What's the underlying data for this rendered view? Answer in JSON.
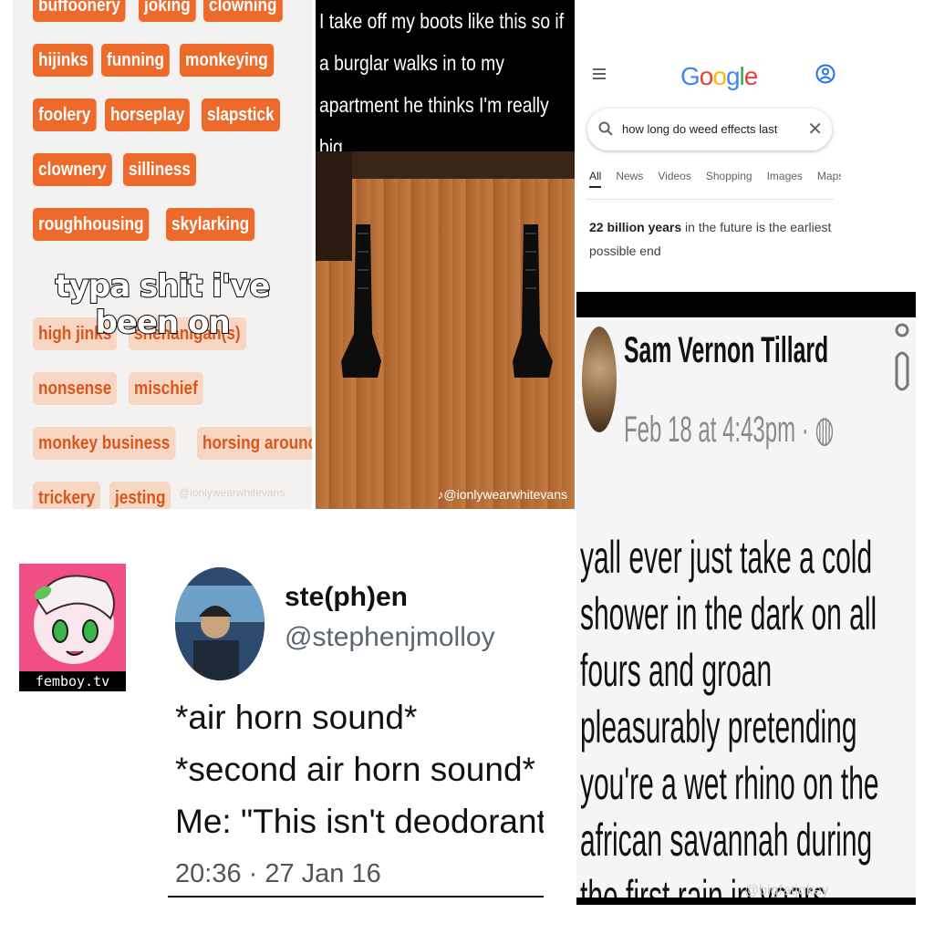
{
  "words_panel": {
    "tags_strong": [
      [
        "buffoonery",
        "joking",
        "clowning"
      ],
      [
        "hijinks",
        "funning",
        "monkeying"
      ],
      [
        "foolery",
        "horseplay",
        "slapstick"
      ],
      [
        "clownery",
        "silliness"
      ],
      [
        "roughhousing",
        "skylarking"
      ]
    ],
    "tags_soft": [
      [
        "high jinks",
        "shenanigan(s)"
      ],
      [
        "nonsense",
        "mischief"
      ],
      [
        "monkey business",
        "horsing around"
      ],
      [
        "trickery",
        "jesting"
      ]
    ],
    "caption": "typa shit i've been on",
    "watermark": "@ionlywearwhitevans",
    "colors": {
      "strong": "#ee6a2a",
      "soft": "#f7d6c3"
    }
  },
  "boots_panel": {
    "text": "I take off my boots like this so if a burglar walks in to my apartment he thinks I'm really big",
    "watermark": "@ionlywearwhitevans"
  },
  "google_panel": {
    "logo": "Google",
    "query": "how long do weed effects last",
    "tabs": [
      "All",
      "News",
      "Videos",
      "Shopping",
      "Images",
      "Maps"
    ],
    "answer_bold": "22 billion years",
    "answer_rest": " in the future is the earliest possible end",
    "icons": [
      "menu-icon",
      "account-icon",
      "search-icon",
      "clear-icon"
    ]
  },
  "facebook_panel": {
    "name": "Sam Vernon Tillard",
    "date": "Feb 18 at 4:43pm · ",
    "post": "yall ever just take a cold shower in the dark on all fours and groan pleasurably pretending you're a wet rhino on the african savannah during the first rain in years",
    "watermark": "@bigfatjokey"
  },
  "logo_panel": {
    "label": "femboy.tv"
  },
  "tweet_panel": {
    "name": "ste(ph)en",
    "handle": "@stephenjmolloy",
    "lines": [
      "*air horn sound*",
      "*second air horn sound*",
      "Me: \"This isn't deodorant.\""
    ],
    "time": "20:36 · 27 Jan 16"
  }
}
